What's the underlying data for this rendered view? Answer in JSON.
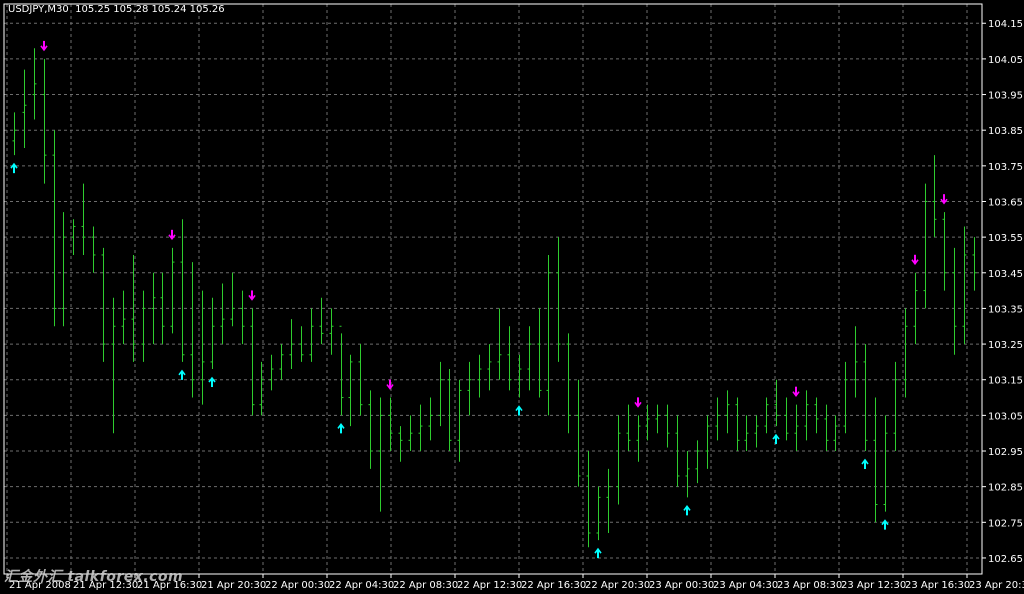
{
  "header": {
    "symbol_timeframe": "USDJPY,M30",
    "ohlc": "105.25 105.28 105.24 105.26"
  },
  "watermark": "汇金外汇 talkforex.com",
  "colors": {
    "background": "#000000",
    "grid": "#6e6e6e",
    "bars": "#2ecc2e",
    "up_arrow": "#00ffff",
    "down_arrow": "#ff00ff",
    "frame": "#ffffff",
    "text": "#ffffff"
  },
  "chart_data": {
    "type": "ohlc",
    "y_ticks": [
      "104.15",
      "104.05",
      "103.95",
      "103.85",
      "103.75",
      "103.65",
      "103.55",
      "103.45",
      "103.35",
      "103.25",
      "103.15",
      "103.05",
      "102.95",
      "102.85",
      "102.75",
      "102.65"
    ],
    "x_ticks": [
      "21 Apr 2008",
      "21 Apr 12:30",
      "21 Apr 16:30",
      "21 Apr 20:30",
      "22 Apr 00:30",
      "22 Apr 04:30",
      "22 Apr 08:30",
      "22 Apr 12:30",
      "22 Apr 16:30",
      "22 Apr 20:30",
      "23 Apr 00:30",
      "23 Apr 04:30",
      "23 Apr 08:30",
      "23 Apr 12:30",
      "23 Apr 16:30",
      "23 Apr 20:30"
    ],
    "ylim": [
      102.605,
      104.204
    ],
    "grid": true,
    "bar_step_time": "30 min",
    "bars": [
      [
        103.82,
        103.9,
        103.78,
        103.85
      ],
      [
        103.9,
        104.02,
        103.8,
        103.92
      ],
      [
        103.95,
        104.08,
        103.88,
        103.98
      ],
      [
        103.95,
        104.05,
        103.7,
        103.78
      ],
      [
        103.78,
        103.85,
        103.3,
        103.35
      ],
      [
        103.35,
        103.62,
        103.3,
        103.55
      ],
      [
        103.55,
        103.6,
        103.5,
        103.58
      ],
      [
        103.58,
        103.7,
        103.5,
        103.55
      ],
      [
        103.55,
        103.58,
        103.45,
        103.5
      ],
      [
        103.5,
        103.52,
        103.2,
        103.25
      ],
      [
        103.25,
        103.38,
        103.0,
        103.3
      ],
      [
        103.3,
        103.4,
        103.25,
        103.32
      ],
      [
        103.32,
        103.5,
        103.2,
        103.25
      ],
      [
        103.25,
        103.4,
        103.2,
        103.35
      ],
      [
        103.35,
        103.45,
        103.25,
        103.38
      ],
      [
        103.38,
        103.45,
        103.25,
        103.3
      ],
      [
        103.3,
        103.52,
        103.28,
        103.48
      ],
      [
        103.48,
        103.6,
        103.2,
        103.22
      ],
      [
        103.22,
        103.48,
        103.1,
        103.15
      ],
      [
        103.15,
        103.4,
        103.08,
        103.2
      ],
      [
        103.2,
        103.38,
        103.18,
        103.3
      ],
      [
        103.3,
        103.42,
        103.25,
        103.32
      ],
      [
        103.32,
        103.45,
        103.3,
        103.35
      ],
      [
        103.35,
        103.4,
        103.25,
        103.3
      ],
      [
        103.3,
        103.35,
        103.05,
        103.08
      ],
      [
        103.08,
        103.2,
        103.05,
        103.15
      ],
      [
        103.15,
        103.22,
        103.12,
        103.18
      ],
      [
        103.18,
        103.25,
        103.15,
        103.22
      ],
      [
        103.22,
        103.32,
        103.18,
        103.25
      ],
      [
        103.25,
        103.3,
        103.2,
        103.22
      ],
      [
        103.22,
        103.35,
        103.2,
        103.3
      ],
      [
        103.3,
        103.38,
        103.25,
        103.28
      ],
      [
        103.28,
        103.35,
        103.22,
        103.3
      ],
      [
        103.3,
        103.28,
        103.05,
        103.1
      ],
      [
        103.1,
        103.22,
        103.02,
        103.2
      ],
      [
        103.2,
        103.25,
        103.05,
        103.08
      ],
      [
        103.08,
        103.12,
        102.9,
        102.95
      ],
      [
        102.95,
        103.1,
        102.78,
        103.05
      ],
      [
        103.05,
        103.1,
        102.95,
        103.0
      ],
      [
        103.0,
        103.02,
        102.92,
        102.98
      ],
      [
        102.98,
        103.05,
        102.95,
        103.0
      ],
      [
        103.0,
        103.08,
        102.95,
        103.02
      ],
      [
        103.02,
        103.1,
        102.98,
        103.05
      ],
      [
        103.05,
        103.2,
        103.02,
        103.15
      ],
      [
        103.15,
        103.18,
        102.95,
        102.98
      ],
      [
        102.98,
        103.15,
        102.92,
        103.12
      ],
      [
        103.12,
        103.2,
        103.05,
        103.15
      ],
      [
        103.15,
        103.22,
        103.1,
        103.18
      ],
      [
        103.18,
        103.25,
        103.12,
        103.2
      ],
      [
        103.2,
        103.35,
        103.15,
        103.22
      ],
      [
        103.22,
        103.3,
        103.12,
        103.15
      ],
      [
        103.15,
        103.22,
        103.1,
        103.18
      ],
      [
        103.18,
        103.3,
        103.12,
        103.25
      ],
      [
        103.25,
        103.35,
        103.1,
        103.12
      ],
      [
        103.12,
        103.5,
        103.05,
        103.45
      ],
      [
        103.45,
        103.55,
        103.2,
        103.25
      ],
      [
        103.25,
        103.28,
        103.0,
        103.05
      ],
      [
        103.05,
        103.15,
        102.85,
        102.88
      ],
      [
        102.88,
        102.95,
        102.68,
        102.72
      ],
      [
        102.72,
        102.85,
        102.7,
        102.82
      ],
      [
        102.82,
        102.9,
        102.72,
        102.85
      ],
      [
        102.85,
        103.05,
        102.8,
        103.0
      ],
      [
        103.0,
        103.08,
        102.95,
        102.98
      ],
      [
        102.98,
        103.05,
        102.92,
        103.02
      ],
      [
        103.02,
        103.08,
        102.98,
        103.04
      ],
      [
        103.04,
        103.08,
        103.0,
        103.05
      ],
      [
        103.05,
        103.08,
        102.96,
        103.0
      ],
      [
        103.0,
        103.05,
        102.85,
        102.88
      ],
      [
        102.88,
        102.95,
        102.82,
        102.9
      ],
      [
        102.9,
        102.98,
        102.86,
        102.95
      ],
      [
        102.95,
        103.05,
        102.9,
        103.02
      ],
      [
        103.02,
        103.1,
        102.98,
        103.05
      ],
      [
        103.05,
        103.12,
        103.0,
        103.08
      ],
      [
        103.08,
        103.1,
        102.95,
        102.98
      ],
      [
        102.98,
        103.05,
        102.95,
        103.0
      ],
      [
        103.0,
        103.05,
        102.96,
        103.02
      ],
      [
        103.02,
        103.1,
        103.0,
        103.08
      ],
      [
        103.08,
        103.15,
        103.02,
        103.05
      ],
      [
        103.05,
        103.1,
        102.98,
        103.0
      ],
      [
        103.0,
        103.08,
        102.95,
        103.02
      ],
      [
        103.02,
        103.12,
        102.98,
        103.08
      ],
      [
        103.08,
        103.1,
        103.0,
        103.04
      ],
      [
        103.04,
        103.08,
        102.95,
        102.98
      ],
      [
        102.98,
        103.05,
        102.95,
        103.02
      ],
      [
        103.02,
        103.2,
        103.0,
        103.15
      ],
      [
        103.15,
        103.3,
        103.1,
        103.2
      ],
      [
        103.2,
        103.25,
        102.95,
        102.98
      ],
      [
        102.98,
        103.1,
        102.75,
        102.8
      ],
      [
        102.8,
        103.05,
        102.78,
        103.0
      ],
      [
        103.0,
        103.2,
        102.95,
        103.15
      ],
      [
        103.15,
        103.35,
        103.1,
        103.3
      ],
      [
        103.3,
        103.45,
        103.25,
        103.4
      ],
      [
        103.4,
        103.7,
        103.35,
        103.65
      ],
      [
        103.65,
        103.78,
        103.55,
        103.6
      ],
      [
        103.6,
        103.62,
        103.4,
        103.45
      ],
      [
        103.45,
        103.52,
        103.22,
        103.3
      ],
      [
        103.3,
        103.58,
        103.25,
        103.5
      ],
      [
        103.5,
        103.55,
        103.4,
        103.45
      ]
    ],
    "up_arrows": [
      0,
      17,
      20,
      33,
      51,
      59,
      68,
      77,
      86,
      88
    ],
    "down_arrows": [
      3,
      16,
      24,
      38,
      63,
      79,
      91,
      94
    ]
  }
}
